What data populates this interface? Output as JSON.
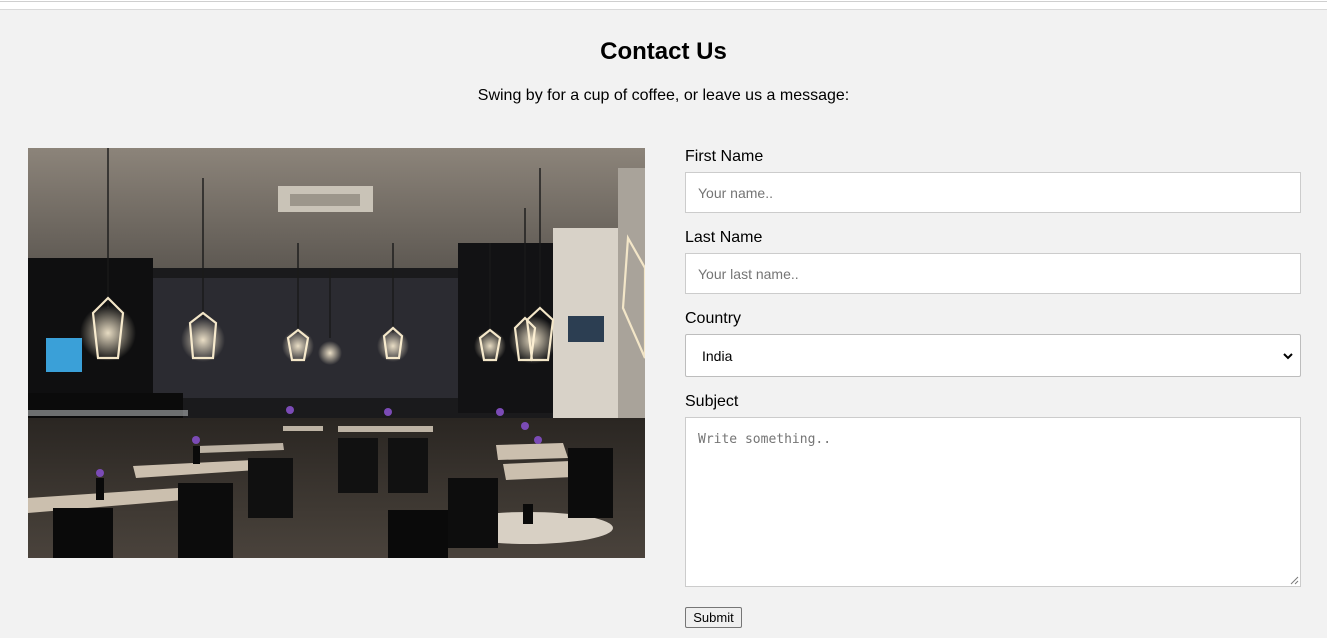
{
  "page": {
    "title": "Contact Us",
    "subtitle": "Swing by for a cup of coffee, or leave us a message:"
  },
  "image": {
    "alt": "Cafe interior"
  },
  "form": {
    "first_name": {
      "label": "First Name",
      "placeholder": "Your name.."
    },
    "last_name": {
      "label": "Last Name",
      "placeholder": "Your last name.."
    },
    "country": {
      "label": "Country",
      "selected": "India"
    },
    "subject": {
      "label": "Subject",
      "placeholder": "Write something.."
    },
    "submit_label": "Submit"
  },
  "colors": {
    "background": "#f2f2f2",
    "field_border": "#cccccc",
    "placeholder": "#757575"
  },
  "icons": {
    "select_arrow": "chevron-down-icon",
    "resize_handle": "resize-grip-icon"
  }
}
